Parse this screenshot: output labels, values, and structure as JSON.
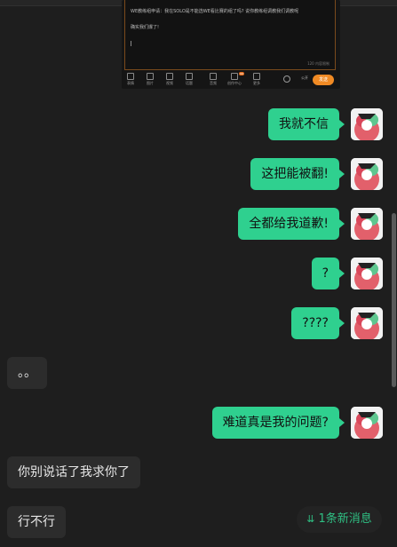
{
  "shared_screenshot": {
    "lines": [
      "WE教练组申请：我在SOLO是不能选WE看比赛的组了吗? 说你教练组调教我们调教呢",
      "",
      "确实我们爆了!"
    ],
    "counter": "120 内容限制",
    "tools": [
      {
        "label": "表情",
        "icon": "emoji-icon"
      },
      {
        "label": "图片",
        "icon": "image-icon"
      },
      {
        "label": "视频",
        "icon": "video-icon"
      },
      {
        "label": "话题",
        "icon": "topic-icon"
      },
      {
        "label": "音频",
        "icon": "audio-icon"
      },
      {
        "label": "创作中心",
        "icon": "creator-icon",
        "badge": "99"
      },
      {
        "label": "更多",
        "icon": "more-icon"
      }
    ],
    "visibility": "公开",
    "send_label": "发送"
  },
  "messages": [
    {
      "side": "me",
      "text": "我就不信"
    },
    {
      "side": "me",
      "text": "这把能被翻!"
    },
    {
      "side": "me",
      "text": "全都给我道歉!"
    },
    {
      "side": "me",
      "text": "?"
    },
    {
      "side": "me",
      "text": "????"
    },
    {
      "side": "them",
      "text": "。。"
    },
    {
      "side": "me",
      "text": "难道真是我的问题?"
    },
    {
      "side": "them",
      "text": "你别说话了我求你了"
    },
    {
      "side": "them",
      "text": "行不行"
    }
  ],
  "new_messages": {
    "label": "1条新消息",
    "icon": "double-chevron-down-icon"
  },
  "colors": {
    "my_bubble": "#2fd08f",
    "their_bubble": "#2c2c2c",
    "background": "#1e1e1e",
    "accent": "#2fbf83"
  }
}
